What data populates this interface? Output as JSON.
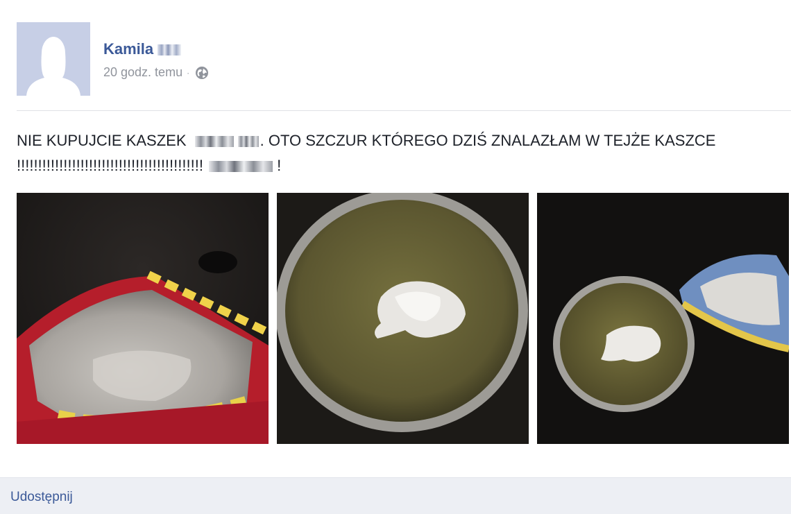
{
  "post": {
    "author": {
      "name": "Kamila"
    },
    "timestamp": "20 godz. temu",
    "separator": "·",
    "privacy_icon": "globe-icon",
    "text_line1_start": "NIE KUPUJCIE KASZEK",
    "text_line1_end": ". OTO SZCZUR KTÓREGO DZIŚ ZNALAZŁAM W TEJŻE KASZCE",
    "text_line2_start": "!!!!!!!!!!!!!!!!!!!!!!!!!!!!!!!!!!!!!!!!!!!!",
    "text_line2_end": "!",
    "photos": [
      {
        "name": "photo-cereal-bag"
      },
      {
        "name": "photo-bowl-with-rat"
      },
      {
        "name": "photo-bowl-and-bag"
      }
    ]
  },
  "actions": {
    "share_label": "Udostępnij"
  },
  "colors": {
    "link": "#3b5998",
    "meta": "#90949c",
    "action_bar": "#edeff4"
  }
}
